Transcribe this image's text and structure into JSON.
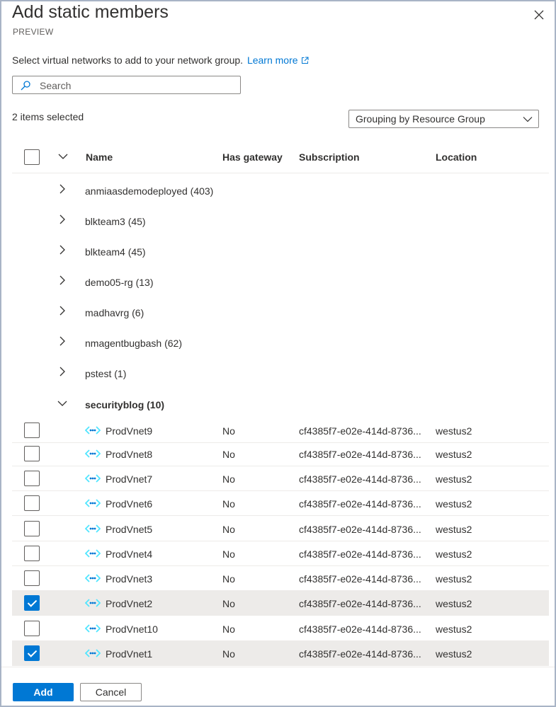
{
  "panel": {
    "title": "Add static members",
    "subtitle": "PREVIEW",
    "description": "Select virtual networks to add to your network group.",
    "learn_more": "Learn more"
  },
  "search": {
    "placeholder": "Search",
    "value": ""
  },
  "selection": {
    "count_text": "2 items selected"
  },
  "grouping": {
    "selected": "Grouping by Resource Group"
  },
  "columns": {
    "name": "Name",
    "gateway": "Has gateway",
    "subscription": "Subscription",
    "location": "Location"
  },
  "groups": [
    {
      "label": "anmiaasdemodeployed (403)",
      "expanded": false
    },
    {
      "label": "blkteam3 (45)",
      "expanded": false
    },
    {
      "label": "blkteam4 (45)",
      "expanded": false
    },
    {
      "label": "demo05-rg (13)",
      "expanded": false
    },
    {
      "label": "madhavrg (6)",
      "expanded": false
    },
    {
      "label": "nmagentbugbash (62)",
      "expanded": false
    },
    {
      "label": "pstest (1)",
      "expanded": false
    },
    {
      "label": "securityblog (10)",
      "expanded": true
    }
  ],
  "vnets": [
    {
      "name": "ProdVnet9",
      "gateway": "No",
      "subscription": "cf4385f7-e02e-414d-8736...",
      "location": "westus2",
      "checked": false
    },
    {
      "name": "ProdVnet8",
      "gateway": "No",
      "subscription": "cf4385f7-e02e-414d-8736...",
      "location": "westus2",
      "checked": false
    },
    {
      "name": "ProdVnet7",
      "gateway": "No",
      "subscription": "cf4385f7-e02e-414d-8736...",
      "location": "westus2",
      "checked": false
    },
    {
      "name": "ProdVnet6",
      "gateway": "No",
      "subscription": "cf4385f7-e02e-414d-8736...",
      "location": "westus2",
      "checked": false
    },
    {
      "name": "ProdVnet5",
      "gateway": "No",
      "subscription": "cf4385f7-e02e-414d-8736...",
      "location": "westus2",
      "checked": false
    },
    {
      "name": "ProdVnet4",
      "gateway": "No",
      "subscription": "cf4385f7-e02e-414d-8736...",
      "location": "westus2",
      "checked": false
    },
    {
      "name": "ProdVnet3",
      "gateway": "No",
      "subscription": "cf4385f7-e02e-414d-8736...",
      "location": "westus2",
      "checked": false
    },
    {
      "name": "ProdVnet2",
      "gateway": "No",
      "subscription": "cf4385f7-e02e-414d-8736...",
      "location": "westus2",
      "checked": true
    },
    {
      "name": "ProdVnet10",
      "gateway": "No",
      "subscription": "cf4385f7-e02e-414d-8736...",
      "location": "westus2",
      "checked": false
    },
    {
      "name": "ProdVnet1",
      "gateway": "No",
      "subscription": "cf4385f7-e02e-414d-8736...",
      "location": "westus2",
      "checked": true
    }
  ],
  "footer": {
    "add_label": "Add",
    "cancel_label": "Cancel"
  },
  "colors": {
    "accent": "#0078d4",
    "text": "#323130",
    "selected_row": "#edebe9",
    "vnet_icon_cyan": "#50e6ff",
    "vnet_icon_blue": "#0078d4"
  },
  "icons": {
    "close": "close-icon",
    "external_link": "external-link-icon",
    "search": "search-icon",
    "chevron": "chevron-icon",
    "vnet": "virtual-network-icon"
  }
}
